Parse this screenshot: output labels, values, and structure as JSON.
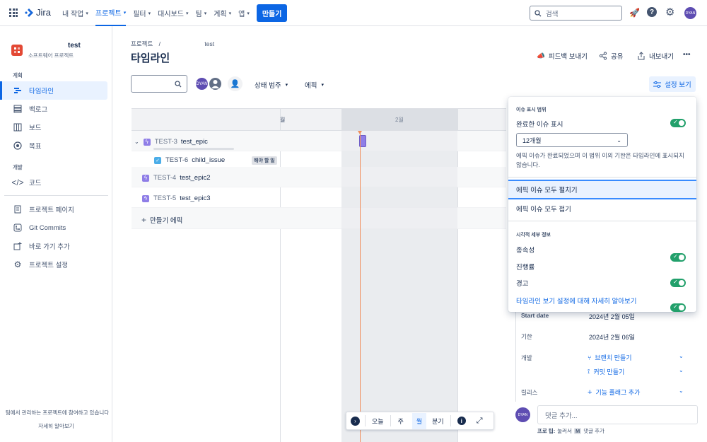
{
  "topbar": {
    "app_name": "Jira",
    "nav": [
      {
        "label": "내 작업",
        "active": false
      },
      {
        "label": "프로젝트",
        "active": true
      },
      {
        "label": "필터",
        "active": false
      },
      {
        "label": "대시보드",
        "active": false
      },
      {
        "label": "팀",
        "active": false
      },
      {
        "label": "계획",
        "active": false
      },
      {
        "label": "앱",
        "active": false
      }
    ],
    "create_label": "만들기",
    "search_placeholder": "검색",
    "avatar_initials": "DYAN"
  },
  "sidebar": {
    "project_name": "test",
    "project_type": "소프트웨어 프로젝트",
    "section_plan": "계획",
    "plan_items": [
      {
        "label": "타임라인",
        "icon": "timeline-icon"
      },
      {
        "label": "백로그",
        "icon": "backlog-icon"
      },
      {
        "label": "보드",
        "icon": "board-icon"
      },
      {
        "label": "목표",
        "icon": "goals-icon"
      }
    ],
    "section_dev": "개발",
    "dev_items": [
      {
        "label": "코드",
        "icon": "code-icon"
      }
    ],
    "other_items": [
      {
        "label": "프로젝트 페이지",
        "icon": "page-icon"
      },
      {
        "label": "Git Commits",
        "icon": "git-icon"
      },
      {
        "label": "바로 가기 추가",
        "icon": "shortcut-icon"
      },
      {
        "label": "프로젝트 설정",
        "icon": "settings-icon"
      }
    ],
    "footer_text": "팀에서 관리하는 프로젝트에 참여하고 있습니다",
    "footer_link": "자세히 알아보기"
  },
  "page": {
    "breadcrumb_root": "프로젝트",
    "breadcrumb_sep": "/",
    "breadcrumb_project": "test",
    "title": "타임라인",
    "feedback": "피드백 보내기",
    "share": "공유",
    "export": "내보내기",
    "more": "•••"
  },
  "toolbar": {
    "avatar_initials": "DYAN",
    "status_filter": "상태 범주",
    "epic_filter": "에픽",
    "view_settings": "설정 보기"
  },
  "timeline": {
    "month_jan_partial": "월",
    "month_feb": "2월",
    "rows": [
      {
        "key": "TEST-3",
        "name": "test_epic",
        "type": "epic"
      },
      {
        "key": "TEST-6",
        "name": "child_issue",
        "type": "task",
        "status": "해야 할 일"
      },
      {
        "key": "TEST-4",
        "name": "test_epic2",
        "type": "epic"
      },
      {
        "key": "TEST-5",
        "name": "test_epic3",
        "type": "epic"
      }
    ],
    "create_epic": "만들기 에픽",
    "bottom_bar": {
      "today": "오늘",
      "week": "주",
      "month": "월",
      "quarter": "분기"
    }
  },
  "settings_panel": {
    "section1": "이슈 표시 범위",
    "completed_label": "완료한 이슈 표시",
    "completed_on": true,
    "range_value": "12개월",
    "range_help": "에픽 이슈가 완료되었으며 이 범위 이외 기한은 타임라인에 표시되지 않습니다.",
    "expand_all": "에픽 이슈 모두 펼치기",
    "collapse_all": "에픽 이슈 모두 접기",
    "section2": "시각적 세부 정보",
    "toggles": [
      {
        "label": "종속성",
        "on": true
      },
      {
        "label": "진행률",
        "on": true
      },
      {
        "label": "경고",
        "on": true
      }
    ],
    "learn_more": "타임라인 보기 설정에 대해 자세히 알아보기"
  },
  "detail": {
    "start_label": "Start date",
    "start_value": "2024년 2월 05일",
    "due_label": "기한",
    "due_value": "2024년 2월 06일",
    "dev_label": "개발",
    "create_branch": "브랜치 만들기",
    "create_commit": "커밋 만들기",
    "release_label": "릴리스",
    "add_flag": "기능 플래그 추가",
    "comment_avatar": "DYAN",
    "comment_placeholder": "댓글 추가...",
    "tip_prefix": "프로 팁:",
    "tip_mid": "눌러서",
    "tip_key": "M",
    "tip_suffix": "댓글 추가"
  },
  "colors": {
    "accent": "#0c66e4",
    "epic": "#8f7ee7",
    "toggle_on": "#22a06b",
    "today_line": "#f18d5a"
  }
}
